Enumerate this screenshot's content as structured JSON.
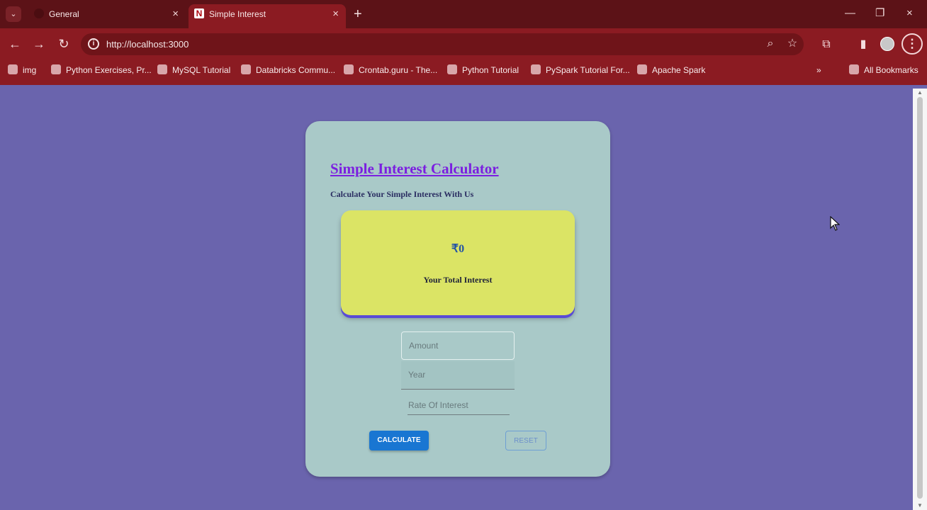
{
  "browser": {
    "tabs": [
      {
        "title": "General"
      },
      {
        "title": "Simple Interest",
        "favicon_letter": "N"
      }
    ],
    "url": "http://localhost:3000",
    "bookmarks": [
      "img",
      "Python Exercises, Pr...",
      "MySQL Tutorial",
      "Databricks Commu...",
      "Crontab.guru - The...",
      "Python Tutorial",
      "PySpark Tutorial For...",
      "Apache Spark"
    ],
    "all_bookmarks": "All Bookmarks"
  },
  "app": {
    "title": "Simple Interest Calculator",
    "subtitle": "Calculate Your Simple Interest With Us",
    "result": {
      "value": "₹0",
      "label": "Your Total Interest"
    },
    "inputs": {
      "amount": "Amount",
      "year": "Year",
      "rate": "Rate Of Interest"
    },
    "buttons": {
      "calculate": "CALCULATE",
      "reset": "RESET"
    }
  },
  "colors": {
    "background": "#6a64ad",
    "card": "#a9c9c8",
    "result_card": "#dbe465",
    "accent": "#1976d2"
  }
}
